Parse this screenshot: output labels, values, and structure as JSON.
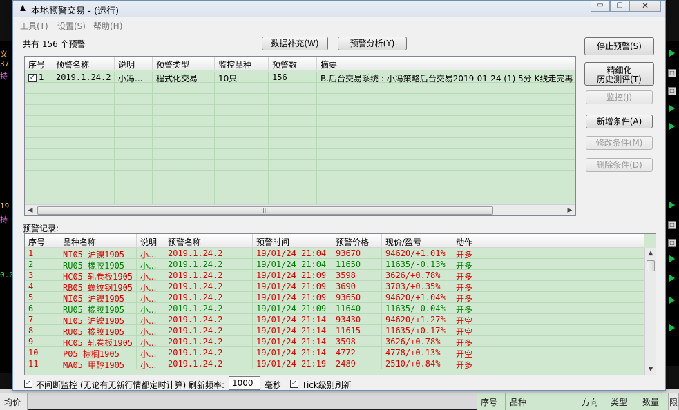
{
  "window": {
    "title": "本地预警交易 - (运行)",
    "controls": {
      "minimize": "▭",
      "maximize": "▢",
      "close": "✕"
    }
  },
  "menu": [
    "工具(T)",
    "设置(S)",
    "帮助(H)"
  ],
  "summary": "共有 156 个预警",
  "top_buttons": {
    "data_fill": "数据补充(W)",
    "alert_analysis": "预警分析(Y)"
  },
  "side_buttons": {
    "stop": "停止预警(S)",
    "refine_line1": "精细化",
    "refine_line2": "历史测评(T)",
    "monitor": "监控(J)",
    "add_condition": "新增条件(A)",
    "edit_condition": "修改条件(M)",
    "delete_condition": "删除条件(D)"
  },
  "alerts_table": {
    "columns": [
      "序号",
      "预警名称",
      "说明",
      "预警类型",
      "监控品种",
      "预警数",
      "摘要"
    ],
    "rows": [
      {
        "checked": true,
        "index": "1",
        "name": "2019.1.24.2",
        "note": "小冯...",
        "type": "程式化交易",
        "monitored": "10只",
        "count": "156",
        "summary": "B.后台交易系统 : 小冯策略后台交易2019-01-24 (1) 5分 K线走完再"
      }
    ]
  },
  "records_label": "预警记录:",
  "records_table": {
    "columns": [
      "序号",
      "品种名称",
      "说明",
      "预警名称",
      "预警时间",
      "预警价格",
      "现价/盈亏",
      "动作"
    ],
    "rows": [
      {
        "index": "1",
        "product": "NI05 沪镍1905",
        "note": "小...",
        "alert_name": "2019.1.24.2",
        "time": "19/01/24 21:04",
        "price": "93670",
        "current": "94620/+1.01%",
        "action": "开多",
        "color": "red"
      },
      {
        "index": "2",
        "product": "RU05 橡胶1905",
        "note": "小...",
        "alert_name": "2019.1.24.2",
        "time": "19/01/24 21:04",
        "price": "11650",
        "current": "11635/-0.13%",
        "action": "开多",
        "color": "green"
      },
      {
        "index": "3",
        "product": "HC05 轧卷板1905",
        "note": "小...",
        "alert_name": "2019.1.24.2",
        "time": "19/01/24 21:09",
        "price": "3598",
        "current": "3626/+0.78%",
        "action": "开多",
        "color": "red"
      },
      {
        "index": "4",
        "product": "RB05 螺纹钢1905",
        "note": "小...",
        "alert_name": "2019.1.24.2",
        "time": "19/01/24 21:09",
        "price": "3690",
        "current": "3703/+0.35%",
        "action": "开多",
        "color": "red"
      },
      {
        "index": "5",
        "product": "NI05 沪镍1905",
        "note": "小...",
        "alert_name": "2019.1.24.2",
        "time": "19/01/24 21:09",
        "price": "93650",
        "current": "94620/+1.04%",
        "action": "开多",
        "color": "red"
      },
      {
        "index": "6",
        "product": "RU05 橡胶1905",
        "note": "小...",
        "alert_name": "2019.1.24.2",
        "time": "19/01/24 21:09",
        "price": "11640",
        "current": "11635/-0.04%",
        "action": "开多",
        "color": "green"
      },
      {
        "index": "7",
        "product": "NI05 沪镍1905",
        "note": "小...",
        "alert_name": "2019.1.24.2",
        "time": "19/01/24 21:14",
        "price": "93430",
        "current": "94620/+1.27%",
        "action": "开空",
        "color": "red"
      },
      {
        "index": "8",
        "product": "RU05 橡胶1905",
        "note": "小...",
        "alert_name": "2019.1.24.2",
        "time": "19/01/24 21:14",
        "price": "11615",
        "current": "11635/+0.17%",
        "action": "开空",
        "color": "red"
      },
      {
        "index": "9",
        "product": "HC05 轧卷板1905",
        "note": "小...",
        "alert_name": "2019.1.24.2",
        "time": "19/01/24 21:14",
        "price": "3598",
        "current": "3626/+0.78%",
        "action": "开多",
        "color": "red"
      },
      {
        "index": "10",
        "product": "P05 棕榈1905",
        "note": "小...",
        "alert_name": "2019.1.24.2",
        "time": "19/01/24 21:14",
        "price": "4772",
        "current": "4778/+0.13%",
        "action": "开空",
        "color": "red"
      },
      {
        "index": "11",
        "product": "MA05 甲醇1905",
        "note": "小...",
        "alert_name": "2019.1.24.2",
        "time": "19/01/24 21:19",
        "price": "2489",
        "current": "2510/+0.84%",
        "action": "开多",
        "color": "red"
      }
    ]
  },
  "footer": {
    "continuous_label": "不间断监控 (无论有无新行情都定时计算) 刷新频率:",
    "continuous_checked": true,
    "refresh_value": "1000",
    "unit": "毫秒",
    "tick_label": "Tick级别刷新",
    "tick_checked": true
  },
  "background": {
    "left_values": [
      "义",
      "37",
      "持",
      "19",
      "持",
      "0.0"
    ],
    "bottom_cells": [
      "均价",
      "序号",
      "品种",
      "方向",
      "类型",
      "数量",
      "限"
    ]
  },
  "colors": {
    "list_bg": "#cfe8cf",
    "red": "#e00000",
    "green": "#008000"
  }
}
